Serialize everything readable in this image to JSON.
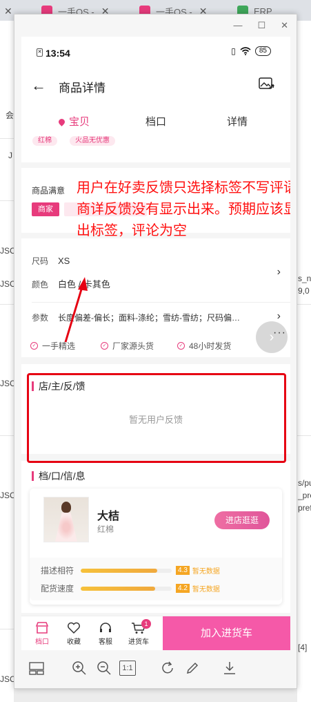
{
  "browser": {
    "tabs": [
      {
        "label": "一手OS -",
        "color": "#e73b7c"
      },
      {
        "label": "一手OS -",
        "color": "#e73b7c"
      },
      {
        "label": "ERP",
        "color": "#3fa75a"
      }
    ],
    "bg_left": [
      "会",
      "J",
      "JSC",
      "JSC",
      "JSC",
      "JSC",
      "JSC"
    ],
    "bg_right": [
      "s_n",
      "9,0",
      "s/pu",
      "_pre",
      "prefi",
      "[4]"
    ]
  },
  "phone": {
    "status": {
      "time": "13:54",
      "battery": "85"
    },
    "nav": {
      "title": "商品详情"
    },
    "tabs": [
      "宝贝",
      "档口",
      "详情"
    ],
    "peek_chips": [
      "红棉",
      "火品无优惠"
    ],
    "satisfaction": {
      "label": "商品满意",
      "tag": "商家"
    },
    "specs": {
      "size_key": "尺码",
      "size_val": "XS",
      "color_key": "颜色",
      "color_val": "白色 / 卡其色",
      "param_key": "参数",
      "param_val": "长度偏差-偏长；面料-涤纶；雪纺-雪纺；尺码偏…"
    },
    "badges": [
      "一手精选",
      "厂家源头货",
      "48小时发货"
    ],
    "feedback": {
      "title": "店/主/反/馈",
      "empty": "暂无用户反馈"
    },
    "store": {
      "title": "档/口/信/息",
      "name": "大桔",
      "sub": "红棉",
      "visit": "进店逛逛",
      "metrics": [
        {
          "label": "描述相符",
          "score": "4.3",
          "fill": 0.84,
          "nodata": "暂无数据"
        },
        {
          "label": "配货速度",
          "score": "4.2",
          "fill": 0.82,
          "nodata": "暂无数据"
        }
      ]
    },
    "bottom": {
      "items": [
        "档口",
        "收藏",
        "客服",
        "进货车"
      ],
      "cart_count": "1",
      "add_cart": "加入进货车"
    }
  },
  "annotation": "用户在好卖反馈只选择标签不写评语，商详反馈没有显示出来。预期应该显示出标签，评论为空",
  "toolbar": {
    "icons": [
      "layout-icon",
      "zoom-in-icon",
      "zoom-out-icon",
      "actual-size-icon",
      "rotate-icon",
      "edit-icon",
      "download-icon"
    ],
    "actual_size": "1:1"
  },
  "colors": {
    "accent": "#e73b7c",
    "annotation": "#ff1010",
    "add_cart": "#f559a8"
  }
}
